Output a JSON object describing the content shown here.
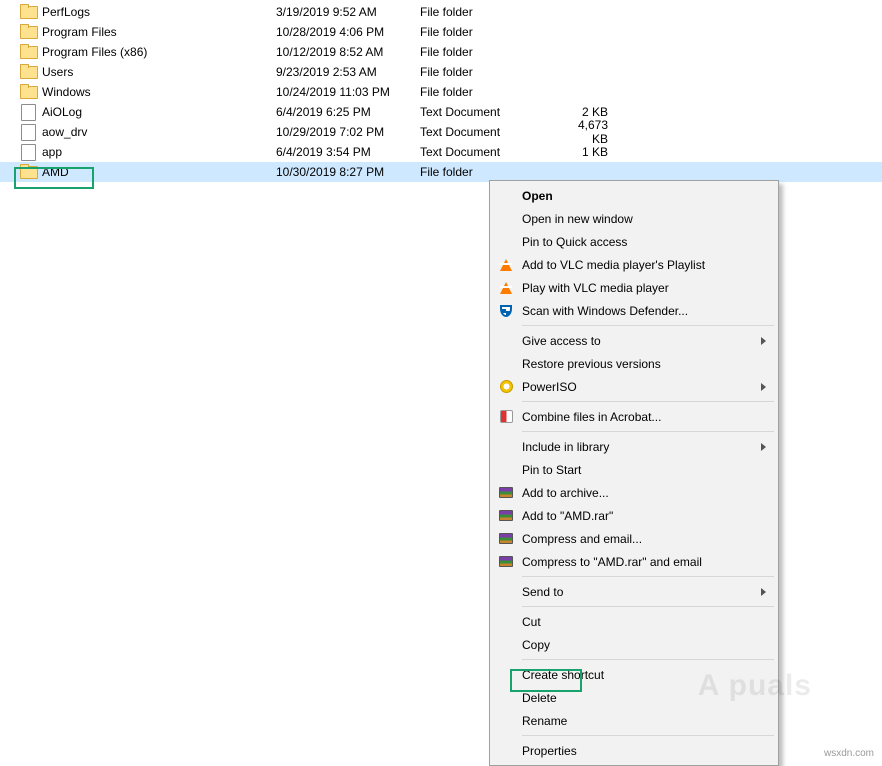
{
  "files": [
    {
      "name": "PerfLogs",
      "date": "3/19/2019 9:52 AM",
      "type": "File folder",
      "size": "",
      "icon": "folder"
    },
    {
      "name": "Program Files",
      "date": "10/28/2019 4:06 PM",
      "type": "File folder",
      "size": "",
      "icon": "folder"
    },
    {
      "name": "Program Files (x86)",
      "date": "10/12/2019 8:52 AM",
      "type": "File folder",
      "size": "",
      "icon": "folder"
    },
    {
      "name": "Users",
      "date": "9/23/2019 2:53 AM",
      "type": "File folder",
      "size": "",
      "icon": "folder"
    },
    {
      "name": "Windows",
      "date": "10/24/2019 11:03 PM",
      "type": "File folder",
      "size": "",
      "icon": "folder"
    },
    {
      "name": "AiOLog",
      "date": "6/4/2019 6:25 PM",
      "type": "Text Document",
      "size": "2 KB",
      "icon": "text"
    },
    {
      "name": "aow_drv",
      "date": "10/29/2019 7:02 PM",
      "type": "Text Document",
      "size": "4,673 KB",
      "icon": "text"
    },
    {
      "name": "app",
      "date": "6/4/2019 3:54 PM",
      "type": "Text Document",
      "size": "1 KB",
      "icon": "text"
    },
    {
      "name": "AMD",
      "date": "10/30/2019 8:27 PM",
      "type": "File folder",
      "size": "",
      "icon": "folder",
      "selected": true
    }
  ],
  "menu": {
    "open": "Open",
    "open_new": "Open in new window",
    "pin_quick": "Pin to Quick access",
    "vlc_add": "Add to VLC media player's Playlist",
    "vlc_play": "Play with VLC media player",
    "defender": "Scan with Windows Defender...",
    "give_access": "Give access to",
    "restore": "Restore previous versions",
    "poweriso": "PowerISO",
    "acrobat": "Combine files in Acrobat...",
    "include_lib": "Include in library",
    "pin_start": "Pin to Start",
    "archive_add": "Add to archive...",
    "archive_add_named": "Add to \"AMD.rar\"",
    "compress_email": "Compress and email...",
    "compress_email_named": "Compress to \"AMD.rar\" and email",
    "send_to": "Send to",
    "cut": "Cut",
    "copy": "Copy",
    "shortcut": "Create shortcut",
    "delete": "Delete",
    "rename": "Rename",
    "properties": "Properties"
  },
  "watermark": "A   puals",
  "footer": "wsxdn.com"
}
